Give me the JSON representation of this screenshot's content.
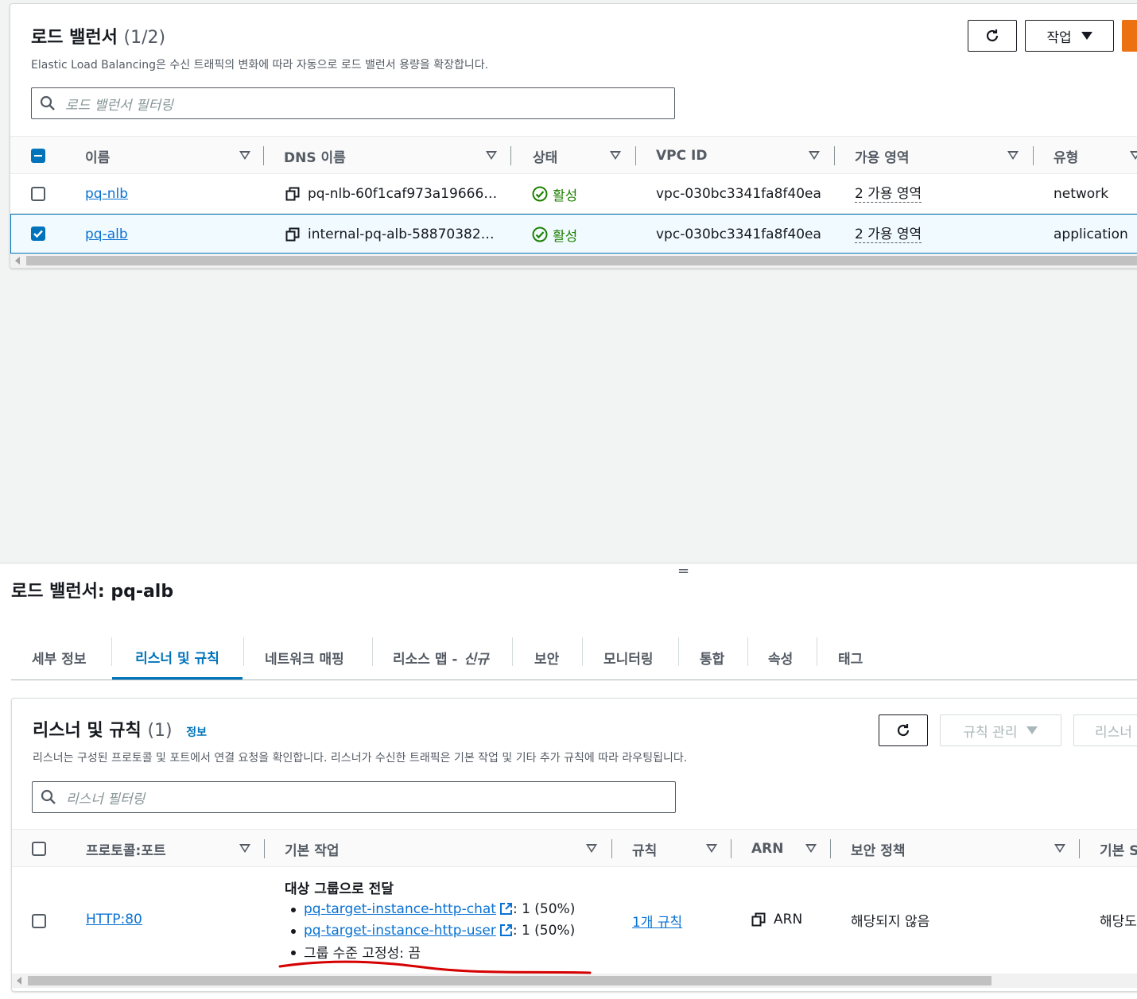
{
  "lb_panel": {
    "title": "로드 밸런서",
    "count": "(1/2)",
    "description": "Elastic Load Balancing은 수신 트래픽의 변화에 따라 자동으로 로드 밸런서 용량을 확장합니다.",
    "actions_label": "작업",
    "search_placeholder": "로드 밸런서 필터링",
    "columns": [
      "이름",
      "DNS 이름",
      "상태",
      "VPC ID",
      "가용 영역",
      "유형"
    ],
    "rows": [
      {
        "name": "pq-nlb",
        "dns": "pq-nlb-60f1caf973a19666…",
        "status": "활성",
        "vpc": "vpc-030bc3341fa8f40ea",
        "az": "2 가용 영역",
        "type": "network",
        "selected": false
      },
      {
        "name": "pq-alb",
        "dns": "internal-pq-alb-58870382…",
        "status": "활성",
        "vpc": "vpc-030bc3341fa8f40ea",
        "az": "2 가용 영역",
        "type": "application",
        "selected": true
      }
    ]
  },
  "detail": {
    "title": "로드 밸런서: pq-alb",
    "tabs": [
      "세부 정보",
      "리스너 및 규칙",
      "네트워크 매핑",
      "리소스 맵 -",
      "보안",
      "모니터링",
      "통합",
      "속성",
      "태그"
    ],
    "tab_new_label": "신규",
    "active_tab": "리스너 및 규칙"
  },
  "listeners": {
    "title": "리스너 및 규칙",
    "count": "(1)",
    "info": "정보",
    "description": "리스너는 구성된 프로토콜 및 포트에서 연결 요청을 확인합니다. 리스너가 수신한 트래픽은 기본 작업 및 기타 추가 규칙에 따라 라우팅됩니다.",
    "manage_rules_label": "규칙 관리",
    "listener_btn_label": "리스너",
    "search_placeholder": "리스너 필터링",
    "columns": [
      "프로토콜:포트",
      "기본 작업",
      "규칙",
      "ARN",
      "보안 정책",
      "기본 S"
    ],
    "row": {
      "protocol": "HTTP:80",
      "action_title": "대상 그룹으로 전달",
      "target1": "pq-target-instance-http-chat",
      "target1_weight": ": 1 (50%)",
      "target2": "pq-target-instance-http-user",
      "target2_weight": ": 1 (50%)",
      "stickiness": "그룹 수준 고정성: 끔",
      "rules": "1개 규칙",
      "arn": "ARN",
      "security_policy": "해당되지 않음",
      "default_ssl": "해당도"
    }
  },
  "colors": {
    "link": "#0972d3",
    "selected": "#0073bb",
    "success": "#1d8102",
    "primary": "#ec7211",
    "annotation": "#d50000"
  }
}
